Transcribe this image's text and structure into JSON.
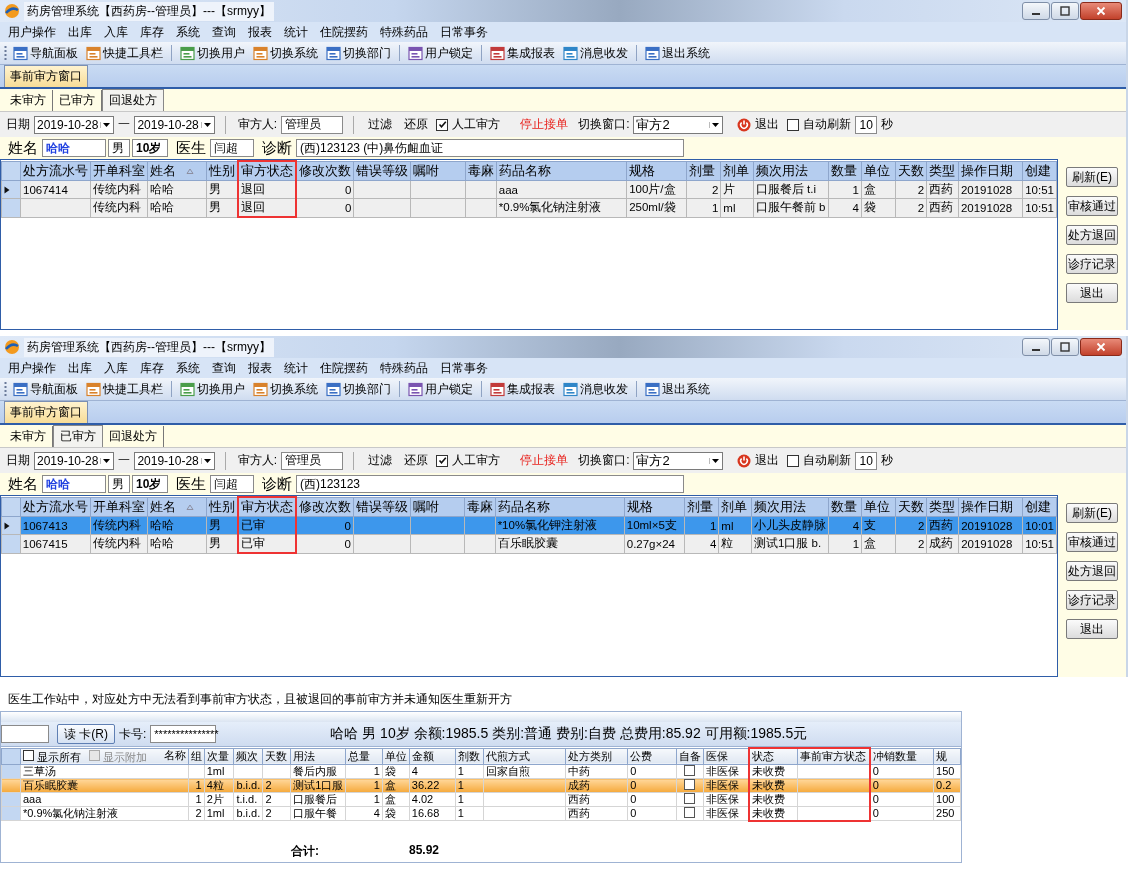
{
  "windows": [
    {
      "title": "药房管理系统【西药房--管理员】---【srmyy】",
      "menu": [
        "用户操作",
        "出库",
        "入库",
        "库存",
        "系统",
        "查询",
        "报表",
        "统计",
        "住院摆药",
        "特殊药品",
        "日常事务"
      ],
      "toolbar_groups": [
        [
          "导航面板",
          "快捷工具栏"
        ],
        [
          "切换用户",
          "切换系统",
          "切换部门"
        ],
        [
          "用户锁定"
        ],
        [
          "集成报表",
          "消息收发"
        ],
        [
          "退出系统"
        ]
      ],
      "document_tab": "事前审方窗口",
      "tabs": [
        {
          "label": "未审方",
          "selected": false
        },
        {
          "label": "已审方",
          "selected": false
        },
        {
          "label": "回退处方",
          "selected": true
        }
      ],
      "filter": {
        "date_label": "日期",
        "date_from": "2019-10-28",
        "date_separator": "一",
        "date_to": "2019-10-28",
        "reviewer_label": "审方人:",
        "reviewer": "管理员",
        "filter_button": "过滤",
        "reset_button": "还原",
        "manual_review": {
          "label": "人工审方",
          "checked": true
        },
        "stop_button": "停止接单",
        "switch_label": "切换窗口:",
        "switch_value": "审方2",
        "exit_button": "退出",
        "auto_refresh": {
          "label": "自动刷新",
          "checked": false
        },
        "interval": "10",
        "interval_unit": "秒"
      },
      "patient": {
        "name_label": "姓名",
        "name": "哈哈",
        "sex": "男",
        "age": "10岁",
        "doctor_label": "医生",
        "doctor": "闫超",
        "diagnosis_label": "诊断",
        "diagnosis": "(西)123123  (中)鼻伤衄血证"
      },
      "table": {
        "columns": [
          {
            "label": "处方流水号",
            "kind": "text",
            "highlighted": false,
            "sorted": false
          },
          {
            "label": "开单科室",
            "kind": "text",
            "highlighted": false,
            "sorted": false
          },
          {
            "label": "姓名",
            "kind": "text",
            "highlighted": false,
            "sorted": true
          },
          {
            "label": "性别",
            "kind": "text",
            "highlighted": false,
            "sorted": false
          },
          {
            "label": "审方状态",
            "kind": "text",
            "highlighted": true,
            "sorted": false
          },
          {
            "label": "修改次数",
            "kind": "number",
            "highlighted": false,
            "sorted": false
          },
          {
            "label": "错误等级",
            "kind": "text",
            "highlighted": false,
            "sorted": false
          },
          {
            "label": "嘱咐",
            "kind": "text",
            "highlighted": false,
            "sorted": false
          },
          {
            "label": "毒麻",
            "kind": "text",
            "highlighted": false,
            "sorted": false
          },
          {
            "label": "药品名称",
            "kind": "text",
            "highlighted": false,
            "sorted": false
          },
          {
            "label": "规格",
            "kind": "text",
            "highlighted": false,
            "sorted": false
          },
          {
            "label": "剂量",
            "kind": "number",
            "highlighted": false,
            "sorted": false
          },
          {
            "label": "剂单",
            "kind": "text",
            "highlighted": false,
            "sorted": false
          },
          {
            "label": "频次用法",
            "kind": "text",
            "highlighted": false,
            "sorted": false
          },
          {
            "label": "数量",
            "kind": "number",
            "highlighted": false,
            "sorted": false
          },
          {
            "label": "单位",
            "kind": "text",
            "highlighted": false,
            "sorted": false
          },
          {
            "label": "天数",
            "kind": "number",
            "highlighted": false,
            "sorted": false
          },
          {
            "label": "类型",
            "kind": "text",
            "highlighted": false,
            "sorted": false
          },
          {
            "label": "操作日期",
            "kind": "text",
            "highlighted": false,
            "sorted": false
          },
          {
            "label": "创建",
            "kind": "text",
            "highlighted": false,
            "sorted": false
          }
        ],
        "rows": [
          {
            "current": true,
            "selected": false,
            "cells": [
              "1067414",
              "传统内科",
              "哈哈",
              "男",
              "退回",
              "0",
              null,
              null,
              null,
              "aaa",
              "100片/盒",
              "2",
              "片",
              "口服餐后 t.i",
              "1",
              "盒",
              "2",
              "西药",
              "20191028",
              "10:51"
            ]
          },
          {
            "current": false,
            "selected": false,
            "cells": [
              null,
              "传统内科",
              "哈哈",
              "男",
              "退回",
              "0",
              null,
              null,
              null,
              "*0.9%氯化钠注射液",
              "250ml/袋",
              "1",
              "ml",
              "口服午餐前 b",
              "4",
              "袋",
              "2",
              "西药",
              "20191028",
              "10:51"
            ]
          }
        ]
      },
      "buttons": [
        "刷新(E)",
        "审核通过",
        "处方退回",
        "诊疗记录",
        "退出"
      ]
    },
    {
      "title": "药房管理系统【西药房--管理员】---【srmyy】",
      "menu": [
        "用户操作",
        "出库",
        "入库",
        "库存",
        "系统",
        "查询",
        "报表",
        "统计",
        "住院摆药",
        "特殊药品",
        "日常事务"
      ],
      "toolbar_groups": [
        [
          "导航面板",
          "快捷工具栏"
        ],
        [
          "切换用户",
          "切换系统",
          "切换部门"
        ],
        [
          "用户锁定"
        ],
        [
          "集成报表",
          "消息收发"
        ],
        [
          "退出系统"
        ]
      ],
      "document_tab": "事前审方窗口",
      "tabs": [
        {
          "label": "未审方",
          "selected": false
        },
        {
          "label": "已审方",
          "selected": true
        },
        {
          "label": "回退处方",
          "selected": false
        }
      ],
      "filter": {
        "date_label": "日期",
        "date_from": "2019-10-28",
        "date_separator": "一",
        "date_to": "2019-10-28",
        "reviewer_label": "审方人:",
        "reviewer": "管理员",
        "filter_button": "过滤",
        "reset_button": "还原",
        "manual_review": {
          "label": "人工审方",
          "checked": true
        },
        "stop_button": "停止接单",
        "switch_label": "切换窗口:",
        "switch_value": "审方2",
        "exit_button": "退出",
        "auto_refresh": {
          "label": "自动刷新",
          "checked": false
        },
        "interval": "10",
        "interval_unit": "秒"
      },
      "patient": {
        "name_label": "姓名",
        "name": "哈哈",
        "sex": "男",
        "age": "10岁",
        "doctor_label": "医生",
        "doctor": "闫超",
        "diagnosis_label": "诊断",
        "diagnosis": "(西)123123"
      },
      "table": {
        "columns": [
          {
            "label": "处方流水号",
            "kind": "text",
            "highlighted": false,
            "sorted": false
          },
          {
            "label": "开单科室",
            "kind": "text",
            "highlighted": false,
            "sorted": false
          },
          {
            "label": "姓名",
            "kind": "text",
            "highlighted": false,
            "sorted": true
          },
          {
            "label": "性别",
            "kind": "text",
            "highlighted": false,
            "sorted": false
          },
          {
            "label": "审方状态",
            "kind": "text",
            "highlighted": true,
            "sorted": false
          },
          {
            "label": "修改次数",
            "kind": "number",
            "highlighted": false,
            "sorted": false
          },
          {
            "label": "错误等级",
            "kind": "text",
            "highlighted": false,
            "sorted": false
          },
          {
            "label": "嘱咐",
            "kind": "text",
            "highlighted": false,
            "sorted": false
          },
          {
            "label": "毒麻",
            "kind": "text",
            "highlighted": false,
            "sorted": false
          },
          {
            "label": "药品名称",
            "kind": "text",
            "highlighted": false,
            "sorted": false
          },
          {
            "label": "规格",
            "kind": "text",
            "highlighted": false,
            "sorted": false
          },
          {
            "label": "剂量",
            "kind": "number",
            "highlighted": false,
            "sorted": false
          },
          {
            "label": "剂单",
            "kind": "text",
            "highlighted": false,
            "sorted": false
          },
          {
            "label": "频次用法",
            "kind": "text",
            "highlighted": false,
            "sorted": false
          },
          {
            "label": "数量",
            "kind": "number",
            "highlighted": false,
            "sorted": false
          },
          {
            "label": "单位",
            "kind": "text",
            "highlighted": false,
            "sorted": false
          },
          {
            "label": "天数",
            "kind": "number",
            "highlighted": false,
            "sorted": false
          },
          {
            "label": "类型",
            "kind": "text",
            "highlighted": false,
            "sorted": false
          },
          {
            "label": "操作日期",
            "kind": "text",
            "highlighted": false,
            "sorted": false
          },
          {
            "label": "创建",
            "kind": "text",
            "highlighted": false,
            "sorted": false
          }
        ],
        "rows": [
          {
            "current": true,
            "selected": true,
            "cells": [
              "1067413",
              "传统内科",
              "哈哈",
              "男",
              "已审",
              "0",
              null,
              null,
              null,
              "*10%氯化钾注射液",
              "10ml×5支",
              "1",
              "ml",
              "小儿头皮静脉",
              "4",
              "支",
              "2",
              "西药",
              "20191028",
              "10:01"
            ]
          },
          {
            "current": false,
            "selected": false,
            "cells": [
              "1067415",
              "传统内科",
              "哈哈",
              "男",
              "已审",
              "0",
              null,
              null,
              null,
              "百乐眠胶囊",
              "0.27g×24",
              "4",
              "粒",
              "测试1口服 b.",
              "1",
              "盒",
              "2",
              "成药",
              "20191028",
              "10:51"
            ]
          }
        ]
      },
      "buttons": [
        "刷新(E)",
        "审核通过",
        "处方退回",
        "诊疗记录",
        "退出"
      ]
    }
  ],
  "caption": "医生工作站中，对应处方中无法看到事前审方状态，且被退回的事前审方并未通知医生重新开方",
  "workstation": {
    "read_card_button": "读 卡(R)",
    "card_label": "卡号:",
    "card_number": "***************",
    "summary": "哈哈  男  10岁  余额:1985.5 类别:普通  费别:自费  总费用:85.92  可用额:1985.5元",
    "show_all": {
      "label": "显示所有",
      "checked": false
    },
    "show_extra": {
      "label": "显示附加",
      "disabled": true
    },
    "columns": [
      {
        "label": "名称",
        "kind": "text",
        "highlighted": false
      },
      {
        "label": "组",
        "kind": "number",
        "highlighted": false
      },
      {
        "label": "次量",
        "kind": "text",
        "highlighted": false
      },
      {
        "label": "频次",
        "kind": "text",
        "highlighted": false
      },
      {
        "label": "天数",
        "kind": "text",
        "highlighted": false
      },
      {
        "label": "用法",
        "kind": "text",
        "highlighted": false
      },
      {
        "label": "总量",
        "kind": "number",
        "highlighted": false
      },
      {
        "label": "单位",
        "kind": "text",
        "highlighted": false
      },
      {
        "label": "金额",
        "kind": "text",
        "highlighted": false
      },
      {
        "label": "剂数",
        "kind": "text",
        "highlighted": false
      },
      {
        "label": "代煎方式",
        "kind": "text",
        "highlighted": false
      },
      {
        "label": "处方类别",
        "kind": "text",
        "highlighted": false
      },
      {
        "label": "公费",
        "kind": "text",
        "highlighted": false
      },
      {
        "label": "自备",
        "kind": "checkbox",
        "highlighted": false
      },
      {
        "label": "医保",
        "kind": "text",
        "highlighted": false
      },
      {
        "label": "状态",
        "kind": "text",
        "highlighted": true
      },
      {
        "label": "事前审方状态",
        "kind": "text",
        "highlighted": true
      },
      {
        "label": "冲销数量",
        "kind": "text",
        "highlighted": false
      },
      {
        "label": "规",
        "kind": "text",
        "highlighted": false
      }
    ],
    "rows": [
      {
        "selected": false,
        "cells": [
          "三草汤",
          null,
          "1ml",
          null,
          null,
          "餐后内服",
          "1",
          "袋",
          "4",
          "1",
          "回家自煎",
          "中药",
          "0",
          false,
          "非医保",
          "未收费",
          null,
          "0",
          "150"
        ]
      },
      {
        "selected": true,
        "cells": [
          "百乐眠胶囊",
          "1",
          "4粒",
          "b.i.d.",
          "2",
          "测试1口服",
          "1",
          "盒",
          "36.22",
          "1",
          null,
          "成药",
          "0",
          false,
          "非医保",
          "未收费",
          null,
          "0",
          "0.2"
        ]
      },
      {
        "selected": false,
        "cells": [
          "aaa",
          "1",
          "2片",
          "t.i.d.",
          "2",
          "口服餐后",
          "1",
          "盒",
          "4.02",
          "1",
          null,
          "西药",
          "0",
          false,
          "非医保",
          "未收费",
          null,
          "0",
          "100"
        ]
      },
      {
        "selected": false,
        "cells": [
          "*0.9%氯化钠注射液",
          "2",
          "1ml",
          "b.i.d.",
          "2",
          "口服午餐",
          "4",
          "袋",
          "16.68",
          "1",
          null,
          "西药",
          "0",
          false,
          "非医保",
          "未收费",
          null,
          "0",
          "250"
        ]
      }
    ],
    "total_label": "合计:",
    "total_value": "85.92"
  }
}
